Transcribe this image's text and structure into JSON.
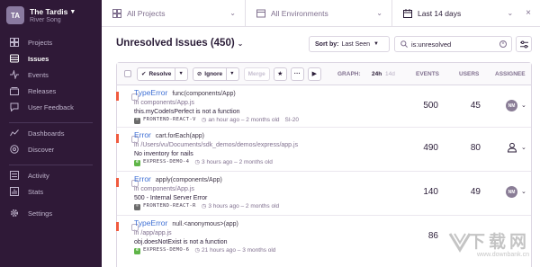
{
  "org": {
    "initials": "TA",
    "name": "The Tardis",
    "user": "River Song"
  },
  "nav": [
    {
      "label": "Projects",
      "icon": "projects-icon"
    },
    {
      "label": "Issues",
      "icon": "issues-icon",
      "active": true
    },
    {
      "label": "Events",
      "icon": "events-icon"
    },
    {
      "label": "Releases",
      "icon": "releases-icon"
    },
    {
      "label": "User Feedback",
      "icon": "feedback-icon"
    },
    {
      "label": "Dashboards",
      "icon": "dashboards-icon"
    },
    {
      "label": "Discover",
      "icon": "discover-icon"
    },
    {
      "label": "Activity",
      "icon": "activity-icon"
    },
    {
      "label": "Stats",
      "icon": "stats-icon"
    },
    {
      "label": "Settings",
      "icon": "settings-icon"
    }
  ],
  "filters": {
    "projects": "All Projects",
    "environments": "All Environments",
    "date": "Last 14 days"
  },
  "title": "Unresolved Issues (450)",
  "sort": {
    "prefix": "Sort by:",
    "value": "Last Seen"
  },
  "search": {
    "value": "is:unresolved"
  },
  "actions": {
    "resolve": "Resolve",
    "ignore": "Ignore",
    "merge": "Merge"
  },
  "columns": {
    "graph": "GRAPH:",
    "g24h": "24h",
    "g14d": "14d",
    "events": "EVENTS",
    "users": "USERS",
    "assignee": "ASSIGNEE"
  },
  "issues": [
    {
      "type": "TypeError",
      "culprit": "func(components/App)",
      "location": "in components/App.js",
      "message": "this.myCodeIsPerfect is not a function",
      "project": "FRONTEND-REACT-V",
      "time": "an hour ago – 2 months old",
      "short_id": "SI-20",
      "platform_color": "#6b6b6b",
      "platform": "R",
      "events": "500",
      "users": "45",
      "assignee": "NM"
    },
    {
      "type": "Error",
      "culprit": "cart.forEach(app)",
      "location": "in /Users/vu/Documents/sdk_demos/demos/express/app.js",
      "message": "No inventory for nails",
      "project": "EXPRESS-DEMO-4",
      "time": "3 hours ago – 2 months old",
      "short_id": "",
      "platform_color": "#5fb548",
      "platform": "E",
      "events": "490",
      "users": "80",
      "assignee": ""
    },
    {
      "type": "Error",
      "culprit": "apply(components/App)",
      "location": "in components/App.js",
      "message": "500 - Internal Server Error",
      "project": "FRONTEND-REACT-R",
      "time": "3 hours ago – 2 months old",
      "short_id": "",
      "platform_color": "#6b6b6b",
      "platform": "R",
      "events": "140",
      "users": "49",
      "assignee": "NM"
    },
    {
      "type": "TypeError",
      "culprit": "null.<anonymous>(app)",
      "location": "in /app/app.js",
      "message": "obj.doesNotExist is not a function",
      "project": "EXPRESS-DEMO-6",
      "time": "21 hours ago – 3 months old",
      "short_id": "",
      "platform_color": "#5fb548",
      "platform": "E",
      "events": "86",
      "users": "",
      "assignee": ""
    }
  ],
  "watermark": {
    "big": "下载网",
    "small": "www.downbank.cn"
  },
  "colors": {
    "sidebar": "#2f1937",
    "link": "#3e6fd4",
    "error_level": "#f05b3f"
  }
}
